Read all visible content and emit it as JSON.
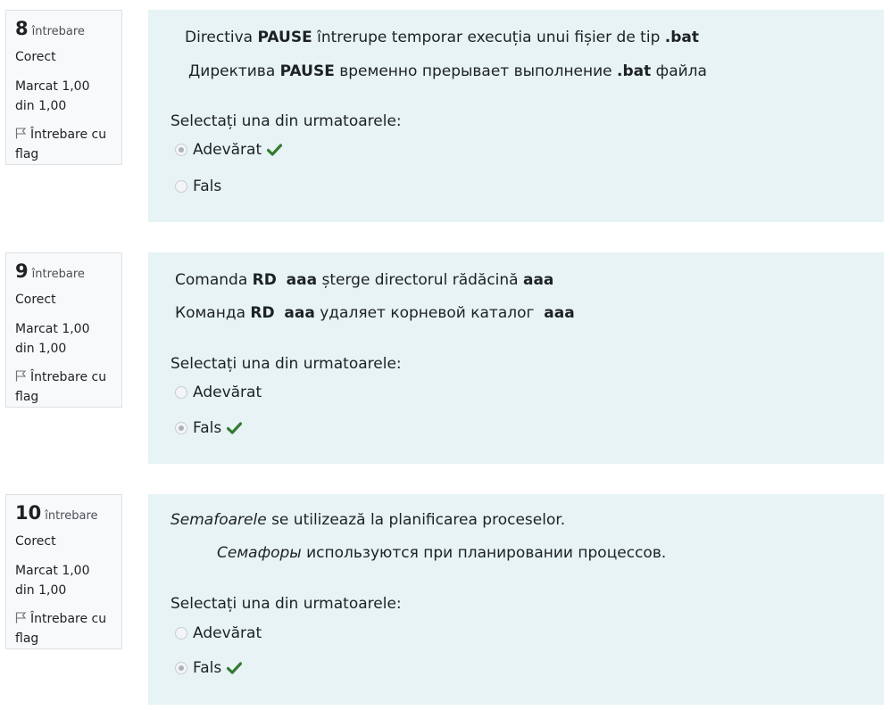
{
  "questions": [
    {
      "number": "8",
      "word": "întrebare",
      "state": "Corect",
      "grade": "Marcat 1,00 din 1,00",
      "flag": "Întrebare cu flag",
      "line1": [
        {
          "t": "Directiva "
        },
        {
          "t": "PAUSE",
          "b": true
        },
        {
          "t": " întrerupe temporar execuția unui fișier de tip "
        },
        {
          "t": ".bat",
          "b": true
        }
      ],
      "line2": [
        {
          "t": "Директива "
        },
        {
          "t": "PAUSE",
          "b": true
        },
        {
          "t": " временно прерывает выполнение "
        },
        {
          "t": ".bat",
          "b": true
        },
        {
          "t": " файла"
        }
      ],
      "prompt": "Selectați una din urmatoarele:",
      "answers": [
        {
          "label": "Adevărat",
          "checked": true,
          "correct": true
        },
        {
          "label": "Fals",
          "checked": false,
          "correct": false
        }
      ]
    },
    {
      "number": "9",
      "word": "întrebare",
      "state": "Corect",
      "grade": "Marcat 1,00 din 1,00",
      "flag": "Întrebare cu flag",
      "line1": [
        {
          "t": "Comanda "
        },
        {
          "t": "RD",
          "b": true
        },
        {
          "t": "  "
        },
        {
          "t": "aaa",
          "b": true
        },
        {
          "t": " șterge directorul rădăcină "
        },
        {
          "t": "aaa",
          "b": true
        }
      ],
      "line2": [
        {
          "t": "Команда "
        },
        {
          "t": "RD",
          "b": true
        },
        {
          "t": "  "
        },
        {
          "t": "aaa",
          "b": true
        },
        {
          "t": " удаляет корневой каталог  "
        },
        {
          "t": "aaa",
          "b": true
        }
      ],
      "prompt": "Selectați una din urmatoarele:",
      "answers": [
        {
          "label": "Adevărat",
          "checked": false,
          "correct": false
        },
        {
          "label": "Fals",
          "checked": true,
          "correct": true
        }
      ]
    },
    {
      "number": "10",
      "word": "întrebare",
      "state": "Corect",
      "grade": "Marcat 1,00 din 1,00",
      "flag": "Întrebare cu flag",
      "line1": [
        {
          "t": "Semafoarele",
          "i": true
        },
        {
          "t": " se utilizează la planificarea proceselor."
        }
      ],
      "line2": [
        {
          "t": "Семафоры",
          "i": true
        },
        {
          "t": " используются при планировании процессов."
        }
      ],
      "prompt": "Selectați una din urmatoarele:",
      "answers": [
        {
          "label": "Adevărat",
          "checked": false,
          "correct": false
        },
        {
          "label": "Fals",
          "checked": true,
          "correct": true
        }
      ]
    }
  ],
  "colors": {
    "correct_check": "#357a32",
    "content_bg": "#e7f3f5",
    "info_bg": "#f8f9fa"
  },
  "icons": {
    "flag": "flag-icon",
    "correct": "check-icon"
  }
}
